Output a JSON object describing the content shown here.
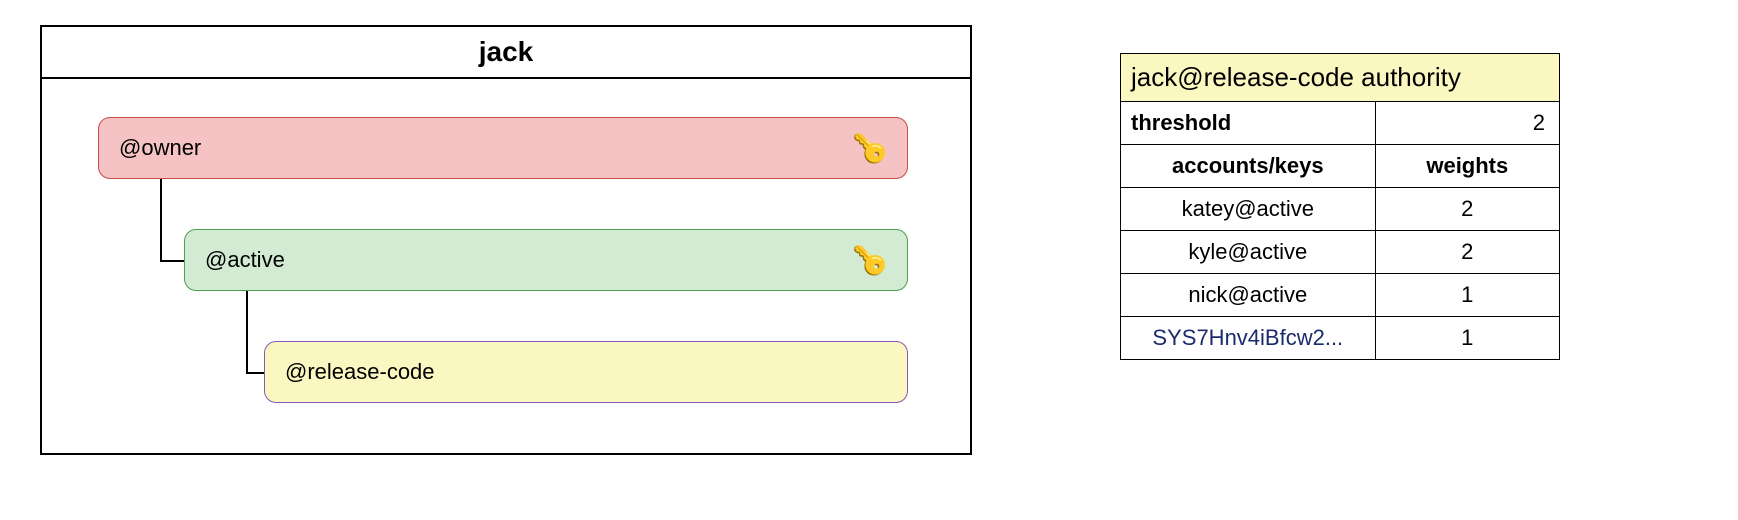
{
  "account": {
    "name": "jack",
    "permissions": {
      "owner": {
        "label": "@owner",
        "has_key": true
      },
      "active": {
        "label": "@active",
        "has_key": true
      },
      "release": {
        "label": "@release-code",
        "has_key": false
      }
    }
  },
  "authority": {
    "title": "jack@release-code authority",
    "threshold_label": "threshold",
    "threshold_value": "2",
    "headers": {
      "accounts": "accounts/keys",
      "weights": "weights"
    },
    "rows": [
      {
        "account": "katey@active",
        "weight": "2",
        "is_key": false
      },
      {
        "account": "kyle@active",
        "weight": "2",
        "is_key": false
      },
      {
        "account": "nick@active",
        "weight": "1",
        "is_key": false
      },
      {
        "account": "SYS7Hnv4iBfcw2...",
        "weight": "1",
        "is_key": true
      }
    ]
  },
  "icons": {
    "key": "🔑"
  }
}
